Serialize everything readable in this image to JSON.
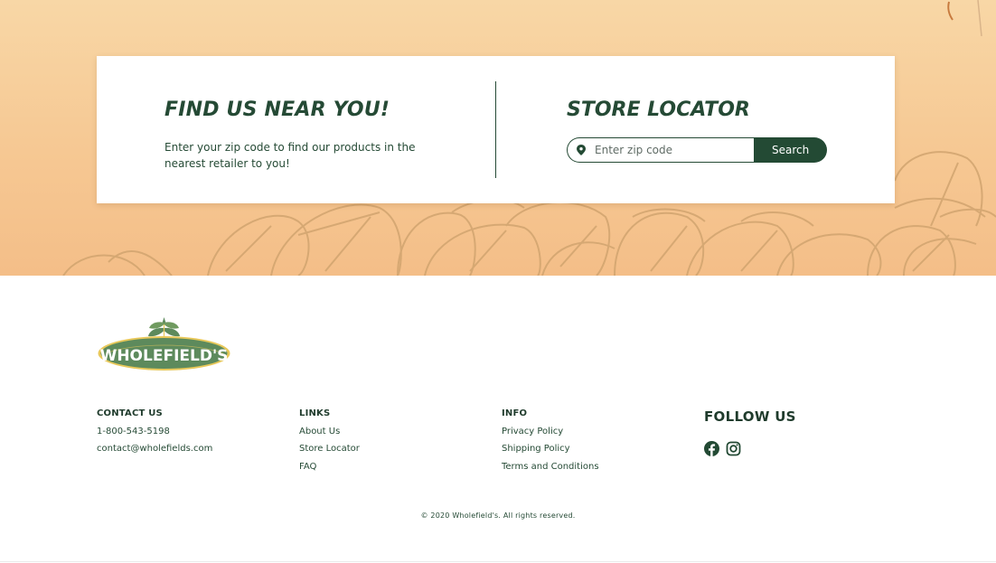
{
  "colors": {
    "brand_green": "#234a34",
    "hero_peach": "#f6c893",
    "leaf_outline": "#d1a46f",
    "logo_green": "#5d8a5c",
    "logo_gold": "#e8c85a"
  },
  "hero": {
    "find_title": "FIND US NEAR YOU!",
    "find_text": "Enter your zip code to find our products in the nearest retailer to you!",
    "locator_title": "STORE LOCATOR",
    "zip_placeholder": "Enter zip code",
    "zip_value": "",
    "search_label": "Search",
    "pin_icon": "map-pin-icon"
  },
  "footer": {
    "logo_text": "WHOLEFIELD'S",
    "contact": {
      "heading": "CONTACT US",
      "phone": "1-800-543-5198",
      "email": "contact@wholefields.com"
    },
    "links": {
      "heading": "LINKS",
      "items": [
        "About Us",
        "Store Locator",
        "FAQ"
      ]
    },
    "info": {
      "heading": "INFO",
      "items": [
        "Privacy Policy",
        "Shipping Policy",
        "Terms and Conditions"
      ]
    },
    "follow": {
      "heading": "FOLLOW US",
      "icons": [
        "facebook-icon",
        "instagram-icon"
      ]
    },
    "copyright": "© 2020 Wholefield's. All rights reserved."
  }
}
